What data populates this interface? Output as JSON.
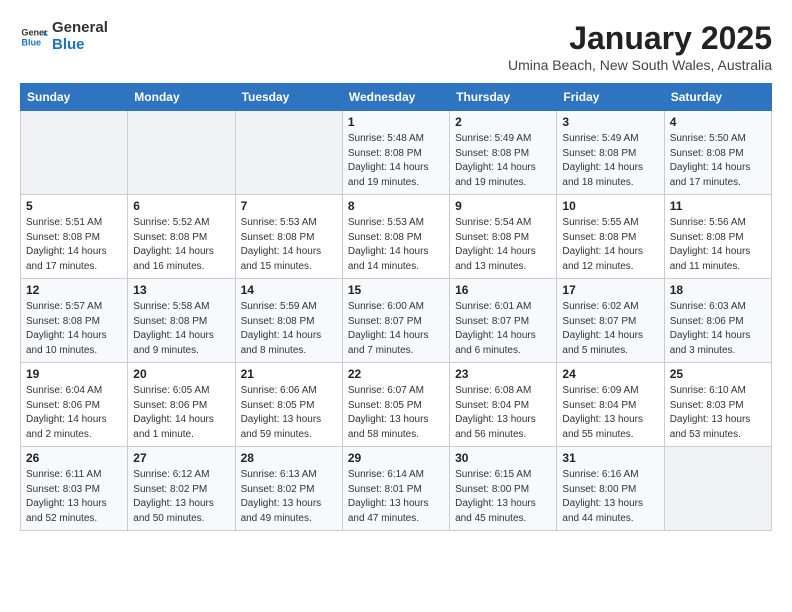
{
  "logo": {
    "line1": "General",
    "line2": "Blue"
  },
  "title": "January 2025",
  "subtitle": "Umina Beach, New South Wales, Australia",
  "weekdays": [
    "Sunday",
    "Monday",
    "Tuesday",
    "Wednesday",
    "Thursday",
    "Friday",
    "Saturday"
  ],
  "weeks": [
    [
      {
        "day": "",
        "info": ""
      },
      {
        "day": "",
        "info": ""
      },
      {
        "day": "",
        "info": ""
      },
      {
        "day": "1",
        "info": "Sunrise: 5:48 AM\nSunset: 8:08 PM\nDaylight: 14 hours\nand 19 minutes."
      },
      {
        "day": "2",
        "info": "Sunrise: 5:49 AM\nSunset: 8:08 PM\nDaylight: 14 hours\nand 19 minutes."
      },
      {
        "day": "3",
        "info": "Sunrise: 5:49 AM\nSunset: 8:08 PM\nDaylight: 14 hours\nand 18 minutes."
      },
      {
        "day": "4",
        "info": "Sunrise: 5:50 AM\nSunset: 8:08 PM\nDaylight: 14 hours\nand 17 minutes."
      }
    ],
    [
      {
        "day": "5",
        "info": "Sunrise: 5:51 AM\nSunset: 8:08 PM\nDaylight: 14 hours\nand 17 minutes."
      },
      {
        "day": "6",
        "info": "Sunrise: 5:52 AM\nSunset: 8:08 PM\nDaylight: 14 hours\nand 16 minutes."
      },
      {
        "day": "7",
        "info": "Sunrise: 5:53 AM\nSunset: 8:08 PM\nDaylight: 14 hours\nand 15 minutes."
      },
      {
        "day": "8",
        "info": "Sunrise: 5:53 AM\nSunset: 8:08 PM\nDaylight: 14 hours\nand 14 minutes."
      },
      {
        "day": "9",
        "info": "Sunrise: 5:54 AM\nSunset: 8:08 PM\nDaylight: 14 hours\nand 13 minutes."
      },
      {
        "day": "10",
        "info": "Sunrise: 5:55 AM\nSunset: 8:08 PM\nDaylight: 14 hours\nand 12 minutes."
      },
      {
        "day": "11",
        "info": "Sunrise: 5:56 AM\nSunset: 8:08 PM\nDaylight: 14 hours\nand 11 minutes."
      }
    ],
    [
      {
        "day": "12",
        "info": "Sunrise: 5:57 AM\nSunset: 8:08 PM\nDaylight: 14 hours\nand 10 minutes."
      },
      {
        "day": "13",
        "info": "Sunrise: 5:58 AM\nSunset: 8:08 PM\nDaylight: 14 hours\nand 9 minutes."
      },
      {
        "day": "14",
        "info": "Sunrise: 5:59 AM\nSunset: 8:08 PM\nDaylight: 14 hours\nand 8 minutes."
      },
      {
        "day": "15",
        "info": "Sunrise: 6:00 AM\nSunset: 8:07 PM\nDaylight: 14 hours\nand 7 minutes."
      },
      {
        "day": "16",
        "info": "Sunrise: 6:01 AM\nSunset: 8:07 PM\nDaylight: 14 hours\nand 6 minutes."
      },
      {
        "day": "17",
        "info": "Sunrise: 6:02 AM\nSunset: 8:07 PM\nDaylight: 14 hours\nand 5 minutes."
      },
      {
        "day": "18",
        "info": "Sunrise: 6:03 AM\nSunset: 8:06 PM\nDaylight: 14 hours\nand 3 minutes."
      }
    ],
    [
      {
        "day": "19",
        "info": "Sunrise: 6:04 AM\nSunset: 8:06 PM\nDaylight: 14 hours\nand 2 minutes."
      },
      {
        "day": "20",
        "info": "Sunrise: 6:05 AM\nSunset: 8:06 PM\nDaylight: 14 hours\nand 1 minute."
      },
      {
        "day": "21",
        "info": "Sunrise: 6:06 AM\nSunset: 8:05 PM\nDaylight: 13 hours\nand 59 minutes."
      },
      {
        "day": "22",
        "info": "Sunrise: 6:07 AM\nSunset: 8:05 PM\nDaylight: 13 hours\nand 58 minutes."
      },
      {
        "day": "23",
        "info": "Sunrise: 6:08 AM\nSunset: 8:04 PM\nDaylight: 13 hours\nand 56 minutes."
      },
      {
        "day": "24",
        "info": "Sunrise: 6:09 AM\nSunset: 8:04 PM\nDaylight: 13 hours\nand 55 minutes."
      },
      {
        "day": "25",
        "info": "Sunrise: 6:10 AM\nSunset: 8:03 PM\nDaylight: 13 hours\nand 53 minutes."
      }
    ],
    [
      {
        "day": "26",
        "info": "Sunrise: 6:11 AM\nSunset: 8:03 PM\nDaylight: 13 hours\nand 52 minutes."
      },
      {
        "day": "27",
        "info": "Sunrise: 6:12 AM\nSunset: 8:02 PM\nDaylight: 13 hours\nand 50 minutes."
      },
      {
        "day": "28",
        "info": "Sunrise: 6:13 AM\nSunset: 8:02 PM\nDaylight: 13 hours\nand 49 minutes."
      },
      {
        "day": "29",
        "info": "Sunrise: 6:14 AM\nSunset: 8:01 PM\nDaylight: 13 hours\nand 47 minutes."
      },
      {
        "day": "30",
        "info": "Sunrise: 6:15 AM\nSunset: 8:00 PM\nDaylight: 13 hours\nand 45 minutes."
      },
      {
        "day": "31",
        "info": "Sunrise: 6:16 AM\nSunset: 8:00 PM\nDaylight: 13 hours\nand 44 minutes."
      },
      {
        "day": "",
        "info": ""
      }
    ]
  ]
}
